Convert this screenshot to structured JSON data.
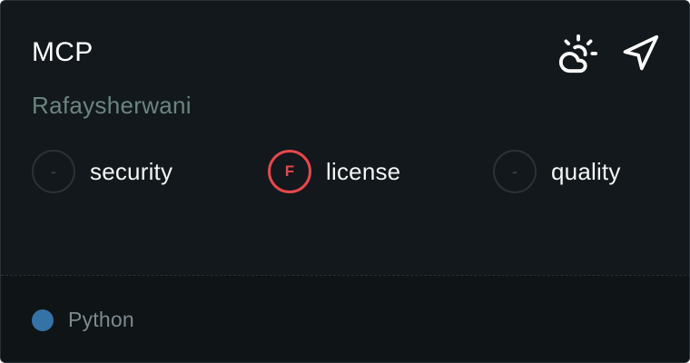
{
  "card": {
    "title": "MCP",
    "owner": "Rafaysherwani",
    "actions": [
      {
        "icon": "cloud-sun-icon"
      },
      {
        "icon": "send-icon"
      }
    ]
  },
  "grades": [
    {
      "grade": "-",
      "label": "security",
      "status": "none"
    },
    {
      "grade": "F",
      "label": "license",
      "status": "fail"
    },
    {
      "grade": "-",
      "label": "quality",
      "status": "none"
    }
  ],
  "footer": {
    "language": "Python",
    "language_color": "#3572A5"
  },
  "colors": {
    "fail": "#e5484d",
    "background": "#12181b",
    "owner_text": "#6b8581"
  }
}
